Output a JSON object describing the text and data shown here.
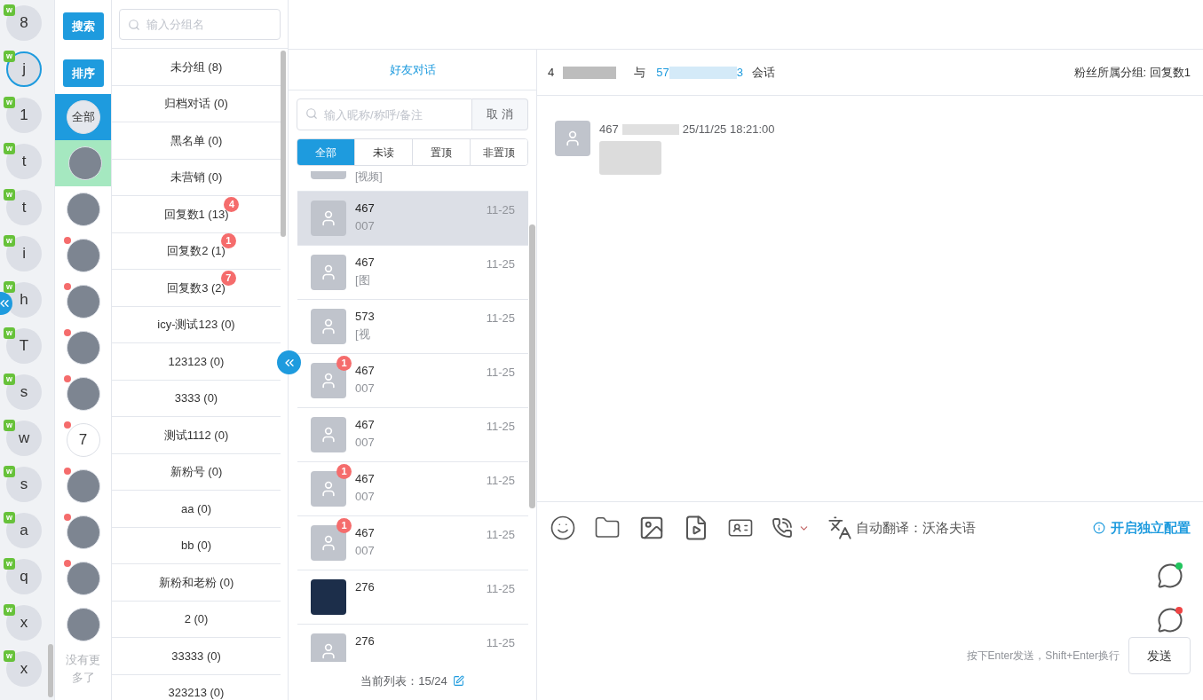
{
  "accounts": [
    {
      "letter": "8",
      "badge": "w",
      "selected": false
    },
    {
      "letter": "j",
      "badge": "w",
      "selected": true
    },
    {
      "letter": "1",
      "badge": "w",
      "selected": false
    },
    {
      "letter": "t",
      "badge": "w",
      "selected": false
    },
    {
      "letter": "t",
      "badge": "w",
      "selected": false
    },
    {
      "letter": "i",
      "badge": "w",
      "selected": false
    },
    {
      "letter": "h",
      "badge": "w",
      "selected": false
    },
    {
      "letter": "T",
      "badge": "w",
      "selected": false
    },
    {
      "letter": "s",
      "badge": "w",
      "selected": false
    },
    {
      "letter": "w",
      "badge": "w",
      "selected": false
    },
    {
      "letter": "s",
      "badge": "w",
      "selected": false
    },
    {
      "letter": "a",
      "badge": "w",
      "selected": false
    },
    {
      "letter": "q",
      "badge": "w",
      "selected": false
    },
    {
      "letter": "x",
      "badge": "w",
      "selected": false
    },
    {
      "letter": "x",
      "badge": "w",
      "selected": false
    }
  ],
  "filter_buttons": [
    "搜索",
    "排序"
  ],
  "friend_filters": [
    {
      "kind": "text",
      "label": "全部",
      "selected": true,
      "unread": false,
      "highlighted": false
    },
    {
      "kind": "photo",
      "selected": false,
      "unread": false,
      "highlighted": true
    },
    {
      "kind": "photo",
      "selected": false,
      "unread": false,
      "highlighted": false
    },
    {
      "kind": "photo",
      "selected": false,
      "unread": true,
      "highlighted": false
    },
    {
      "kind": "photo",
      "selected": false,
      "unread": true,
      "highlighted": false
    },
    {
      "kind": "photo",
      "selected": false,
      "unread": true,
      "highlighted": false
    },
    {
      "kind": "photo",
      "selected": false,
      "unread": true,
      "highlighted": false
    },
    {
      "kind": "text",
      "label": "7",
      "selected": false,
      "unread": true,
      "highlighted": false
    },
    {
      "kind": "photo",
      "selected": false,
      "unread": true,
      "highlighted": false
    },
    {
      "kind": "photo",
      "selected": false,
      "unread": true,
      "highlighted": false
    },
    {
      "kind": "photo",
      "selected": false,
      "unread": true,
      "highlighted": false
    },
    {
      "kind": "photo",
      "selected": false,
      "unread": false,
      "highlighted": false
    }
  ],
  "no_more": "没有更多了",
  "group_search": {
    "placeholder": "输入分组名"
  },
  "groups": [
    {
      "label": "未分组 (8)"
    },
    {
      "label": "归档对话 (0)"
    },
    {
      "label": "黑名单 (0)"
    },
    {
      "label": "未营销 (0)"
    },
    {
      "label": "回复数1 (13)",
      "badge": "4"
    },
    {
      "label": "回复数2 (1)",
      "badge": "1"
    },
    {
      "label": "回复数3 (2)",
      "badge": "7"
    },
    {
      "label": "icy-测试123 (0)"
    },
    {
      "label": "123123 (0)"
    },
    {
      "label": "3333 (0)"
    },
    {
      "label": "测试1112 (0)"
    },
    {
      "label": "新粉号 (0)"
    },
    {
      "label": "aa (0)"
    },
    {
      "label": "bb (0)"
    },
    {
      "label": "新粉和老粉 (0)"
    },
    {
      "label": "2 (0)"
    },
    {
      "label": "33333 (0)"
    },
    {
      "label": "323213 (0)"
    }
  ],
  "conversations": {
    "title": "好友对话",
    "search": {
      "placeholder": "输入昵称/称呼/备注"
    },
    "cancel": "取 消",
    "tabs": [
      {
        "label": "全部",
        "selected": true
      },
      {
        "label": "未读",
        "selected": false
      },
      {
        "label": "置顶",
        "selected": false
      },
      {
        "label": "非置顶",
        "selected": false
      }
    ],
    "items": [
      {
        "kind": "partial",
        "preview": "[视频]",
        "selected": false
      },
      {
        "kind": "user",
        "name": "467",
        "preview": "007",
        "time": "11-25",
        "selected": true
      },
      {
        "kind": "user",
        "name": "467",
        "preview": "[图",
        "time": "11-25",
        "selected": false
      },
      {
        "kind": "user",
        "name": "573",
        "preview": "[视",
        "time": "11-25",
        "selected": false
      },
      {
        "kind": "user",
        "name": "467",
        "preview": "007",
        "time": "11-25",
        "badge": "1",
        "selected": false
      },
      {
        "kind": "user",
        "name": "467",
        "preview": "007",
        "time": "11-25",
        "selected": false
      },
      {
        "kind": "user",
        "name": "467",
        "preview": "007",
        "time": "11-25",
        "badge": "1",
        "selected": false
      },
      {
        "kind": "user",
        "name": "467",
        "preview": "007",
        "time": "11-25",
        "badge": "1",
        "selected": false
      },
      {
        "kind": "photo",
        "name": "276",
        "time": "11-25",
        "selected": false
      },
      {
        "kind": "user",
        "name": "276",
        "time": "11-25",
        "selected": false
      }
    ],
    "footer": "当前列表：15/24"
  },
  "chat": {
    "from": "4",
    "with": "与",
    "to_head": "57",
    "to_tail": "3",
    "suffix": "会话",
    "group": "粉丝所属分组: 回复数1",
    "messages": [
      {
        "sender": "467",
        "time": "25/11/25 18:21:00"
      }
    ],
    "translate": "自动翻译：沃洛夫语",
    "config_link": "开启独立配置",
    "quick_replies": [
      {
        "color": "#22c55e"
      },
      {
        "color": "#ef4444"
      }
    ],
    "hint": "按下Enter发送，Shift+Enter换行",
    "send": "发送"
  }
}
